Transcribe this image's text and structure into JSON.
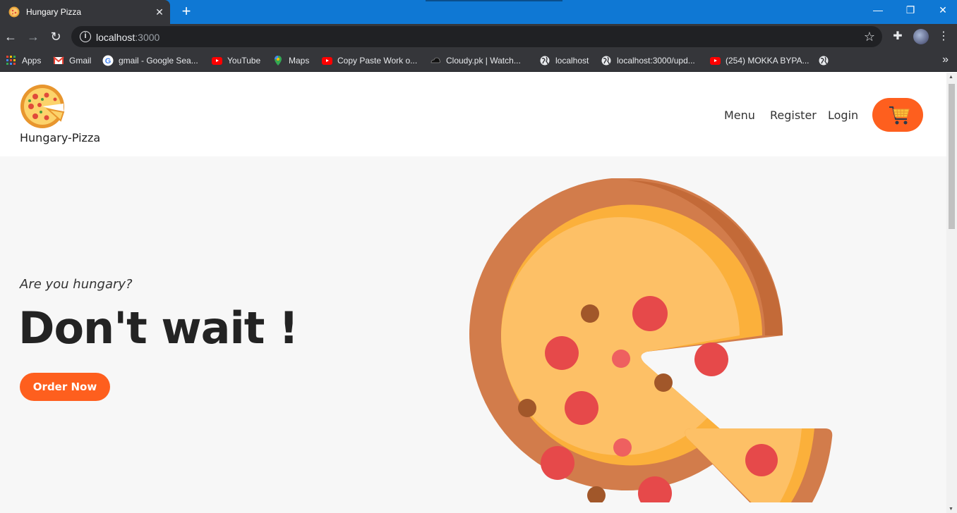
{
  "browser": {
    "tab_title": "Hungary Pizza",
    "url_host": "localhost",
    "url_port": ":3000",
    "bookmarks": [
      {
        "label": "Apps",
        "icon": "apps-grid-icon"
      },
      {
        "label": "Gmail",
        "icon": "gmail-icon"
      },
      {
        "label": "gmail - Google Sea...",
        "icon": "google-icon"
      },
      {
        "label": "YouTube",
        "icon": "youtube-icon"
      },
      {
        "label": "Maps",
        "icon": "maps-icon"
      },
      {
        "label": "Copy Paste Work o...",
        "icon": "youtube-icon"
      },
      {
        "label": "Cloudy.pk | Watch...",
        "icon": "cloudy-icon"
      },
      {
        "label": "localhost",
        "icon": "globe-icon"
      },
      {
        "label": "localhost:3000/upd...",
        "icon": "globe-icon"
      },
      {
        "label": "(254) MOKKA BYPA...",
        "icon": "youtube-icon"
      }
    ]
  },
  "site": {
    "brand": "Hungary-Pizza",
    "nav": {
      "menu": "Menu",
      "register": "Register",
      "login": "Login"
    },
    "hero": {
      "subtitle": "Are you hungary?",
      "title": "Don't wait !",
      "cta": "Order Now"
    },
    "colors": {
      "accent": "#fe5f1e",
      "crust": "#d27c4b",
      "cheese": "#fdc066",
      "pepperoni": "#e6494a"
    }
  }
}
